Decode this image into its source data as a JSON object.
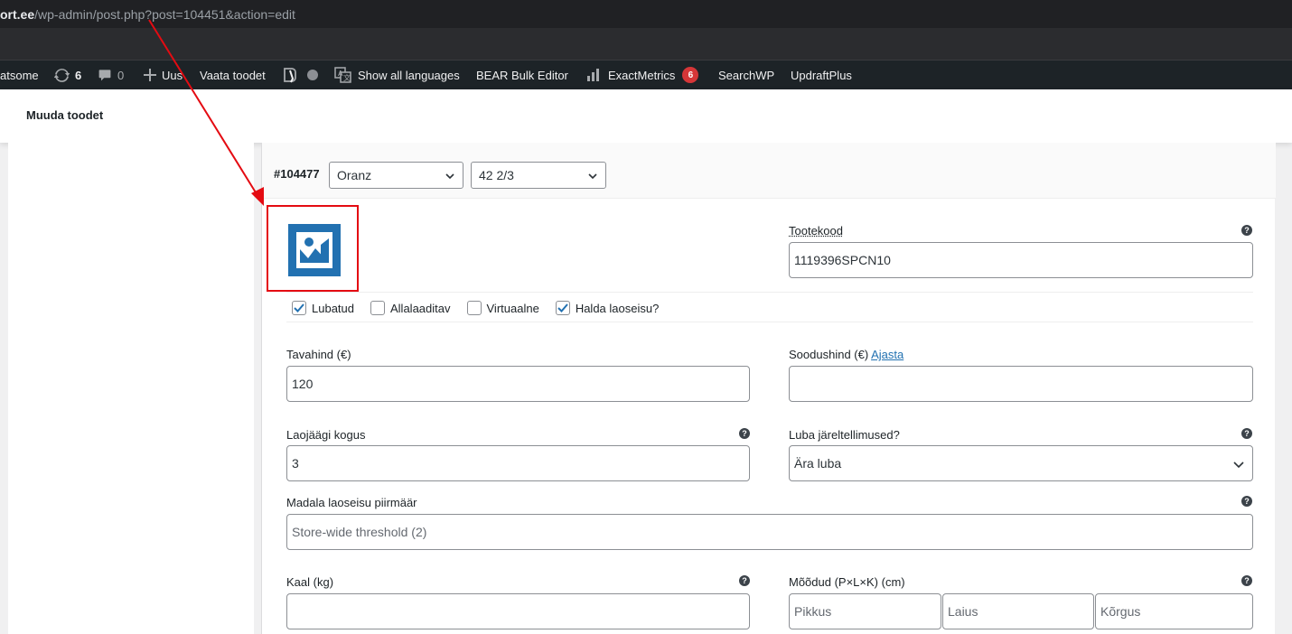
{
  "browser": {
    "url_host": "ort.ee",
    "url_path": "/wp-admin/post.php?post=104451&action=edit"
  },
  "adminbar": {
    "site": "atsome",
    "updates_count": "6",
    "comments_count": "0",
    "new_label": "Uus",
    "view_products": "Vaata toodet",
    "show_languages": "Show all languages",
    "bear_bulk": "BEAR Bulk Editor",
    "exactmetrics": "ExactMetrics",
    "exactmetrics_count": "6",
    "searchwp": "SearchWP",
    "updraftplus": "UpdraftPlus"
  },
  "page": {
    "title": "Muuda toodet"
  },
  "variation": {
    "id": "#104477",
    "color_value": "Oranz",
    "size_value": "42 2/3",
    "sku_label": "Tootekood",
    "sku_value": "1119396SPCN10",
    "checkboxes": {
      "enabled": "Lubatud",
      "downloadable": "Allalaaditav",
      "virtual": "Virtuaalne",
      "manage_stock": "Halda laoseisu?"
    },
    "regular_price_label": "Tavahind (€)",
    "regular_price_value": "120",
    "sale_price_label": "Soodushind (€)",
    "sale_schedule_link": "Ajasta",
    "stock_qty_label": "Laojäägi kogus",
    "stock_qty_value": "3",
    "backorders_label": "Luba järeltellimused?",
    "backorders_value": "Ära luba",
    "low_stock_label": "Madala laoseisu piirmäär",
    "low_stock_placeholder": "Store-wide threshold (2)",
    "weight_label": "Kaal (kg)",
    "dimensions_label": "Mõõdud (P×L×K) (cm)",
    "length_placeholder": "Pikkus",
    "width_placeholder": "Laius",
    "height_placeholder": "Kõrgus"
  },
  "colors": {
    "annotation_red": "#e40b12",
    "wp_blue": "#2271b1",
    "adminbar_bg": "#1d2327",
    "badge_red": "#d63638"
  }
}
